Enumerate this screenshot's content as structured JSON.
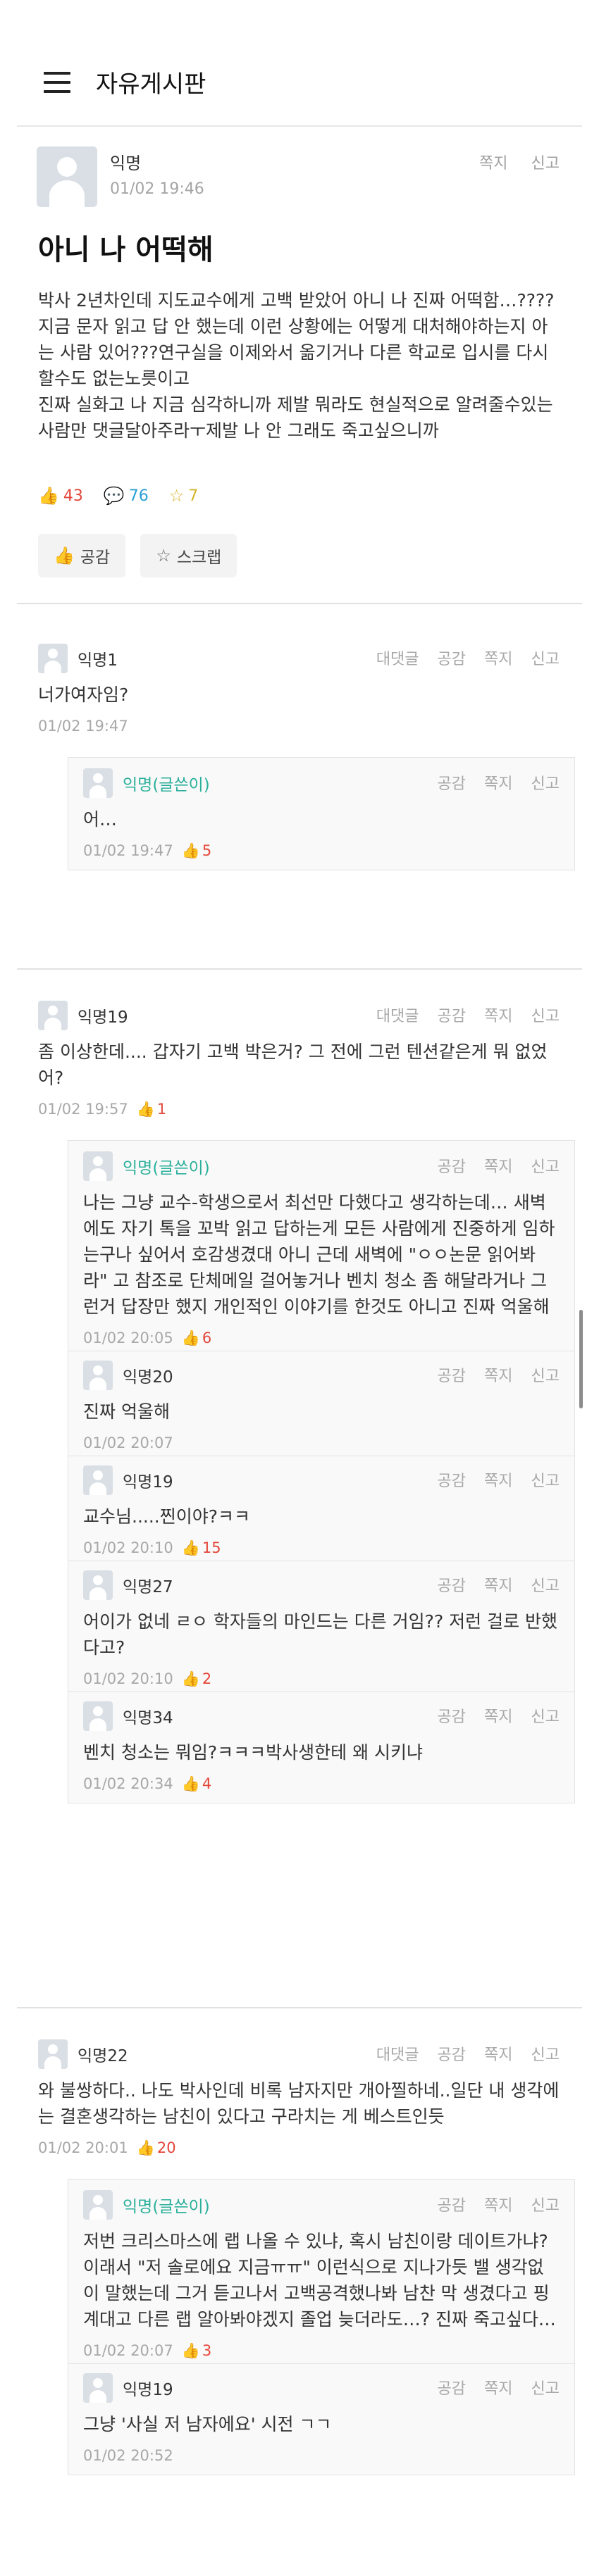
{
  "header": {
    "title": "자유게시판"
  },
  "post": {
    "author": "익명",
    "time": "01/02 19:46",
    "actions": {
      "message": "쪽지",
      "report": "신고"
    },
    "title": "아니 나 어떡해",
    "body_lines": [
      "박사 2년차인데 지도교수에게 고백 받았어 아니 나 진짜 어떡함…????",
      "지금 문자 읽고 답 안 했는데 이런 상황에는 어떻게 대처해야하는지 아",
      "는 사람 있어???연구실을 이제와서 옮기거나 다른 학교로 입시를 다시",
      "할수도 없는노릇이고",
      "진짜 실화고 나 지금 심각하니까 제발 뭐라도 현실적으로 알려줄수있는",
      "사람만 댓글달아주라ㅜ제발 나 안 그래도 죽고싶으니까"
    ],
    "stats": {
      "likes": "43",
      "comments": "76",
      "scraps": "7"
    },
    "buttons": {
      "like": "공감",
      "scrap": "스크랩"
    }
  },
  "comment_actions": {
    "reply": "대댓글",
    "like": "공감",
    "message": "쪽지",
    "report": "신고"
  },
  "comments": [
    {
      "author": "익명1",
      "lines": [
        "너가여자임?"
      ],
      "time": "01/02 19:47",
      "likes": "",
      "replies": [
        {
          "author": "익명(글쓴이)",
          "lines": [
            "어…"
          ],
          "time": "01/02 19:47",
          "likes": "5"
        }
      ]
    },
    {
      "author": "익명19",
      "lines": [
        "좀 이상한데.... 갑자기 고백 박은거? 그 전에 그런 텐션같은게 뭐 없었",
        "어?"
      ],
      "time": "01/02 19:57",
      "likes": "1",
      "replies": [
        {
          "author": "익명(글쓴이)",
          "lines": [
            "나는 그냥 교수-학생으로서 최선만 다했다고 생각하는데… 새벽",
            "에도 자기 톡을 꼬박 읽고 답하는게 모든 사람에게 진중하게 임하",
            "는구나 싶어서 호감생겼대 아니 근데 새벽에 \"ㅇㅇ논문 읽어봐",
            "라\" 고 참조로 단체메일 걸어놓거나 벤치 청소 좀 해달라거나 그",
            "런거 답장만 했지 개인적인 이야기를 한것도 아니고 진짜 억울해"
          ],
          "time": "01/02 20:05",
          "likes": "6"
        },
        {
          "author": "익명20",
          "lines": [
            "진짜 억울해"
          ],
          "time": "01/02 20:07",
          "likes": ""
        },
        {
          "author": "익명19",
          "lines": [
            "교수님.....찐이야?ㅋㅋ"
          ],
          "time": "01/02 20:10",
          "likes": "15"
        },
        {
          "author": "익명27",
          "lines": [
            "어이가 없네 ㄹㅇ 학자들의 마인드는 다른 거임?? 저런 걸로 반했",
            "다고?"
          ],
          "time": "01/02 20:10",
          "likes": "2"
        },
        {
          "author": "익명34",
          "lines": [
            "벤치 청소는 뭐임?ㅋㅋㅋ박사생한테 왜 시키냐"
          ],
          "time": "01/02 20:34",
          "likes": "4"
        }
      ]
    },
    {
      "author": "익명22",
      "lines": [
        "와 불쌍하다.. 나도 박사인데 비록 남자지만 개아찔하네..일단 내 생각에",
        "는 결혼생각하는 남친이 있다고 구라치는 게 베스트인듯"
      ],
      "time": "01/02 20:01",
      "likes": "20",
      "replies": [
        {
          "author": "익명(글쓴이)",
          "lines": [
            "저번 크리스마스에 랩 나올 수 있냐, 혹시 남친이랑 데이트가냐?",
            "이래서 \"저 솔로에요 지금ㅠㅠ\" 이런식으로 지나가듯 밸 생각없",
            "이 말했는데 그거 듣고나서 고백공격했나봐 남찬 막 생겼다고 핑",
            "계대고 다른 랩 알아봐야겠지 졸업 늦더라도…? 진짜 죽고싶다…"
          ],
          "time": "01/02 20:07",
          "likes": "3"
        },
        {
          "author": "익명19",
          "lines": [
            "그냥 '사실 저 남자에요' 시전 ㄱㄱ"
          ],
          "time": "01/02 20:52",
          "likes": ""
        }
      ]
    }
  ],
  "colors": {
    "accent_op": "#2ab09b",
    "like_red": "#e4473a",
    "comment_blue": "#2a9fd6",
    "scrap_yellow": "#d5b42b"
  },
  "icons": {
    "menu": "hamburger-icon",
    "like": "thumbs-up-icon",
    "comment": "speech-bubble-icon",
    "scrap": "star-icon"
  }
}
